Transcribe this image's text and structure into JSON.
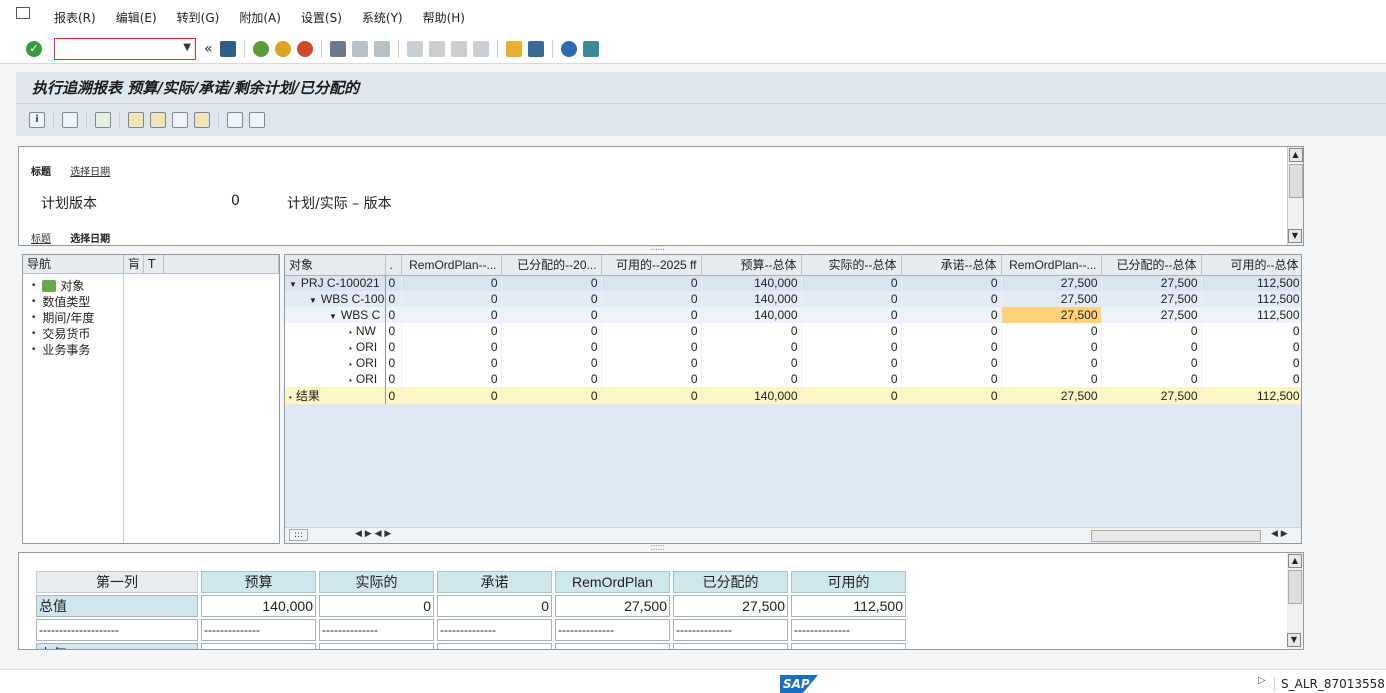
{
  "menu": [
    "报表(R)",
    "编辑(E)",
    "转到(G)",
    "附加(A)",
    "设置(S)",
    "系统(Y)",
    "帮助(H)"
  ],
  "toolbar": {
    "command_value": ""
  },
  "title": "执行追溯报表 预算/实际/承诺/剩余计划/已分配的",
  "header": {
    "tab_top_active": "标题",
    "tab_top_link": "选择日期",
    "plan_label": "计划版本",
    "plan_value": "0",
    "plan_desc": "计划/实际 – 版本",
    "tab_bottom_link": "标题",
    "tab_bottom_active": "选择日期"
  },
  "nav": {
    "header": "导航",
    "items": [
      "对象",
      "数值类型",
      "期间/年度",
      "交易货币",
      "业务事务"
    ]
  },
  "grid": {
    "columns": [
      "对象",
      ".",
      "RemOrdPlan--...",
      "已分配的--20...",
      "可用的--2025 ff",
      "预算--总体",
      "实际的--总体",
      "承诺--总体",
      "RemOrdPlan--...",
      "已分配的--总体",
      "可用的--总体"
    ],
    "rows": [
      {
        "obj": "PRJ C-100021",
        "level": 0,
        "expand": "▼",
        "cells": [
          "0",
          "0",
          "0",
          "0",
          "140,000",
          "0",
          "0",
          "27,500",
          "27,500",
          "112,500"
        ]
      },
      {
        "obj": "WBS C-100",
        "level": 1,
        "expand": "▼",
        "cells": [
          "0",
          "0",
          "0",
          "0",
          "140,000",
          "0",
          "0",
          "27,500",
          "27,500",
          "112,500"
        ]
      },
      {
        "obj": "WBS C",
        "level": 2,
        "expand": "▼",
        "cells": [
          "0",
          "0",
          "0",
          "0",
          "140,000",
          "0",
          "0",
          "27,500",
          "27,500",
          "112,500"
        ]
      },
      {
        "obj": "NW",
        "level": 3,
        "expand": "•",
        "cells": [
          "0",
          "0",
          "0",
          "0",
          "0",
          "0",
          "0",
          "0",
          "0",
          "0"
        ]
      },
      {
        "obj": "ORI",
        "level": 3,
        "expand": "•",
        "cells": [
          "0",
          "0",
          "0",
          "0",
          "0",
          "0",
          "0",
          "0",
          "0",
          "0"
        ]
      },
      {
        "obj": "ORI",
        "level": 3,
        "expand": "•",
        "cells": [
          "0",
          "0",
          "0",
          "0",
          "0",
          "0",
          "0",
          "0",
          "0",
          "0"
        ]
      },
      {
        "obj": "ORI",
        "level": 3,
        "expand": "•",
        "cells": [
          "0",
          "0",
          "0",
          "0",
          "0",
          "0",
          "0",
          "0",
          "0",
          "0"
        ]
      },
      {
        "obj": "结果",
        "level": -1,
        "expand": "•",
        "cells": [
          "0",
          "0",
          "0",
          "0",
          "140,000",
          "0",
          "0",
          "27,500",
          "27,500",
          "112,500"
        ]
      }
    ]
  },
  "summary": {
    "headers": [
      "第一列",
      "预算",
      "实际的",
      "承诺",
      "RemOrdPlan",
      "已分配的",
      "可用的"
    ],
    "total_label": "总值",
    "total_values": [
      "140,000",
      "0",
      "0",
      "27,500",
      "27,500",
      "112,500"
    ],
    "dash_first": "--------------------",
    "dash_other": "--------------",
    "partial_label": "上年"
  },
  "status": {
    "transaction": "S_ALR_87013558",
    "logo": "SAP"
  },
  "colors": {
    "highlight": "#ffd27a",
    "total_row": "#fdf5c4",
    "header_bg": "#dfe7ee"
  }
}
